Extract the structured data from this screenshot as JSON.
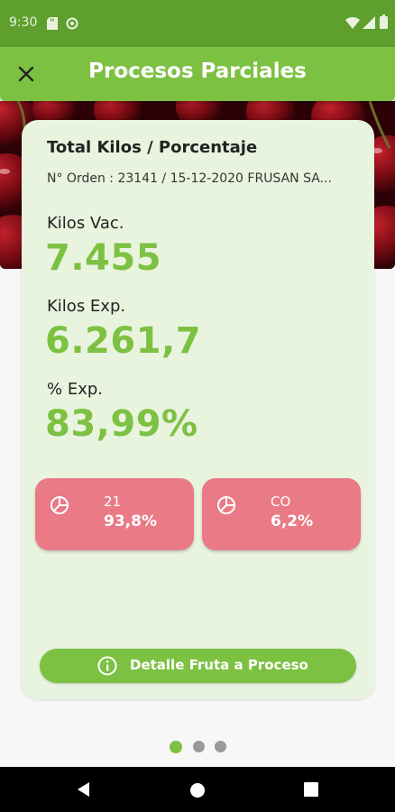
{
  "status_bar": {
    "time": "9:30",
    "icons": [
      "sd-card-icon",
      "sync-icon",
      "wifi-icon",
      "signal-icon",
      "battery-icon"
    ]
  },
  "app_bar": {
    "title": "Procesos Parciales",
    "close_icon": "close-icon"
  },
  "colors": {
    "primary": "#7dc143",
    "status_bar": "#5e9f2e",
    "card_background": "#e9f4df",
    "chip_background": "#e97a86",
    "active_dot": "#7dc143",
    "inactive_dot": "#999999"
  },
  "card": {
    "title": "Total Kilos / Porcentaje",
    "order_text": "N° Orden : 23141 / 15-12-2020 FRUSAN SA...",
    "metrics": [
      {
        "label": "Kilos Vac.",
        "value": "7.455"
      },
      {
        "label": "Kilos Exp.",
        "value": "6.261,7"
      },
      {
        "label": "% Exp.",
        "value": "83,99%"
      }
    ],
    "chips": [
      {
        "name": "21",
        "value": "93,8%",
        "icon": "pie-chart-icon"
      },
      {
        "name": "CO",
        "value": "6,2%",
        "icon": "pie-chart-icon"
      }
    ],
    "detail_button": {
      "label": "Detalle Fruta a Proceso",
      "icon": "info-icon"
    }
  },
  "pager": {
    "count": 3,
    "active_index": 0
  },
  "nav_bar": {
    "buttons": [
      "back-icon",
      "home-icon",
      "recents-icon"
    ]
  }
}
